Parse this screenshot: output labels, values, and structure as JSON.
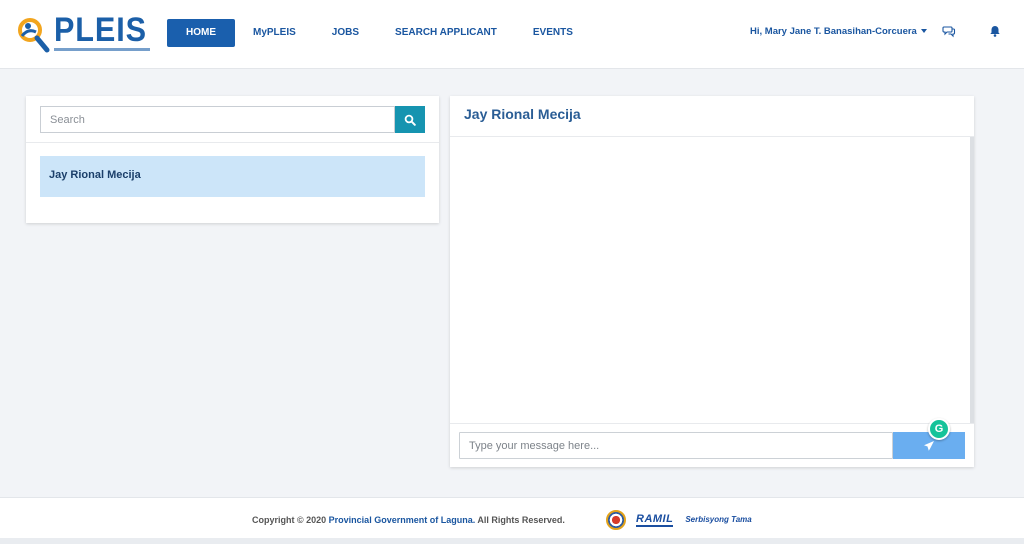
{
  "brand": {
    "name": "PLEIS",
    "color": "#1b5fa8"
  },
  "nav": {
    "items": [
      {
        "label": "HOME",
        "active": true
      },
      {
        "label": "MyPLEIS",
        "active": false
      },
      {
        "label": "JOBS",
        "active": false
      },
      {
        "label": "SEARCH APPLICANT",
        "active": false
      },
      {
        "label": "EVENTS",
        "active": false
      }
    ]
  },
  "user": {
    "greeting": "Hi, Mary Jane T. Banasihan-Corcuera"
  },
  "header_icons": [
    "chat-bubbles-icon",
    "bell-icon"
  ],
  "contacts": {
    "search_placeholder": "Search",
    "items": [
      {
        "name": "Jay Rional Mecija",
        "selected": true
      }
    ]
  },
  "chat": {
    "title": "Jay Rional Mecija",
    "input_placeholder": "Type your message here...",
    "messages": []
  },
  "footer": {
    "copyright_prefix": "Copyright © 2020",
    "organization": "Provincial Government of Laguna.",
    "rights": "All Rights Reserved.",
    "partner_logo_1": "RAMIL",
    "partner_logo_2": "Serbisyong Tama"
  },
  "colors": {
    "primary": "#1a5fad",
    "search_button": "#1694b0",
    "selected_contact": "#cce5f9",
    "send_button": "#6aaef0",
    "background": "#f2f4f7"
  }
}
